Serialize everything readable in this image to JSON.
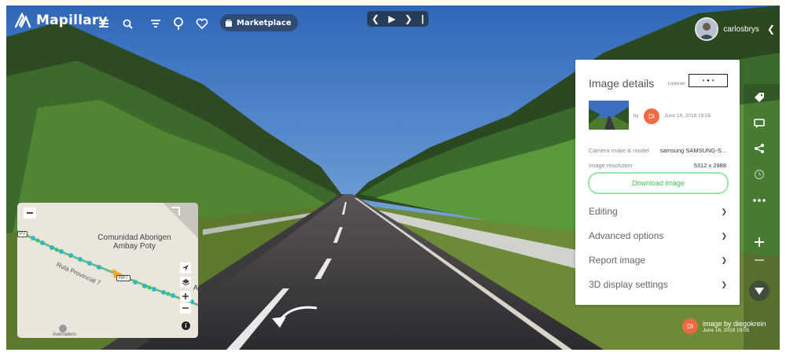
{
  "header": {
    "brand": "Mapillary",
    "marketplace_label": "Marketplace",
    "username": "carlosbrys"
  },
  "icons": {
    "menu": "hamburger-icon",
    "search": "search-icon",
    "filter": "filter-icon",
    "layers": "traffic-sign-icon",
    "heart": "heart-icon",
    "prev": "chevron-left-icon",
    "play": "play-icon",
    "next": "chevron-right-icon"
  },
  "details": {
    "title": "Image details",
    "license_label": "License:",
    "by_label": "by",
    "author_initials": "DI",
    "date": "June 16, 2018 19:05",
    "camera_label": "Camera make & model",
    "camera_value": "samsung SAMSUNG-S...",
    "resolution_label": "Image resolution",
    "resolution_value": "5312 x 2988",
    "download_label": "Download image",
    "sections": [
      "Editing",
      "Advanced options",
      "Report image",
      "3D display settings"
    ]
  },
  "minimap": {
    "place_line1": "Comunidad Aborigen",
    "place_line2": "Ambay Poty",
    "road_label": "Ruta Provincial 7",
    "shield_rp7": "RP7",
    "shield_edge": "P7",
    "poi_label": "Aserradero",
    "edge_letter": "A"
  },
  "credit": {
    "initials": "DI",
    "image_by": "image by diegokrein",
    "date": "June 16, 2018 19:05"
  },
  "colors": {
    "accent_green": "#3fbf5a",
    "avatar_orange": "#ee6a43",
    "route_teal": "#2fb8c8"
  }
}
